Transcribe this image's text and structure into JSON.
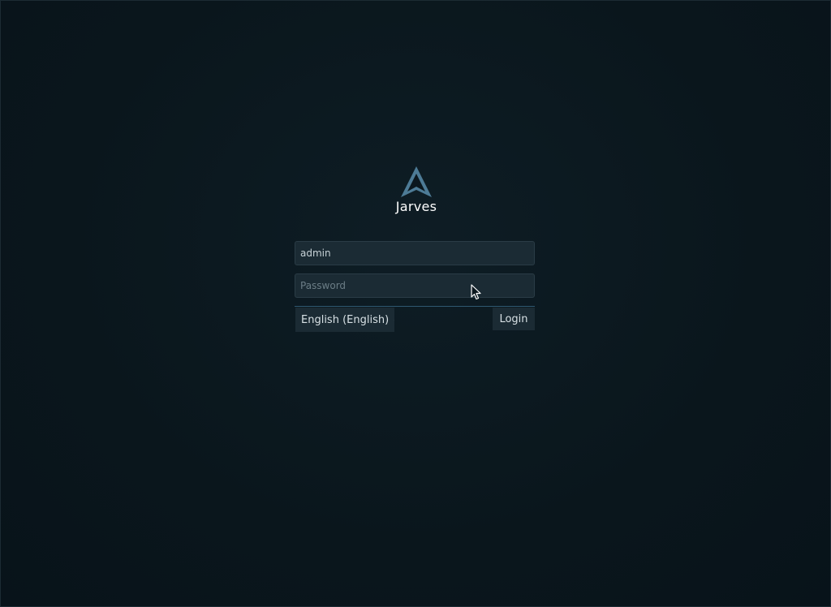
{
  "brand": {
    "name": "Jarves",
    "logo_icon": "triangle-logo-icon",
    "accent_color": "#5a8aa5"
  },
  "form": {
    "username": {
      "value": "admin",
      "placeholder": ""
    },
    "password": {
      "value": "",
      "placeholder": "Password"
    },
    "language": {
      "selected": "English (English)",
      "icon": "chevron-down-icon"
    },
    "login_label": "Login"
  },
  "colors": {
    "background": "#0b171e",
    "field_background": "#1b2b34",
    "divider": "#2f5870",
    "text": "#d7e0e4"
  }
}
